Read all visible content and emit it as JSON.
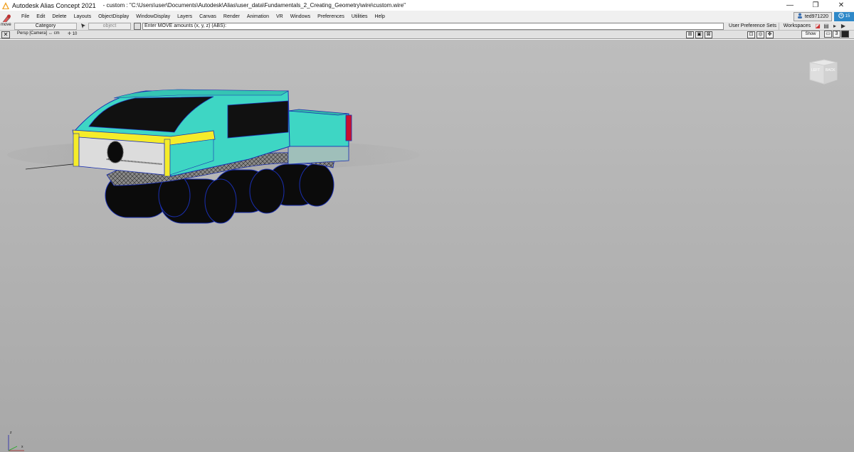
{
  "titlebar": {
    "app_title": "Autodesk Alias Concept 2021",
    "doc_title": "- custom : \"C:\\Users\\user\\Documents\\Autodesk\\Alias\\user_data\\Fundamentals_2_Creating_Geometry\\wire\\custom.wire\""
  },
  "window_controls": {
    "minimize": "—",
    "restore": "❐",
    "close": "✕"
  },
  "menu": {
    "items": [
      "File",
      "Edit",
      "Delete",
      "Layouts",
      "ObjectDisplay",
      "WindowDisplay",
      "Layers",
      "Canvas",
      "Render",
      "Animation",
      "VR",
      "Windows",
      "Preferences",
      "Utilities",
      "Help"
    ]
  },
  "user": {
    "name": "ted971220",
    "clock_text": "15"
  },
  "prompt": {
    "tool_name": "move",
    "category": "Category",
    "object_placeholder": "object",
    "input_value": "Enter MOVE amounts (x, y, z) (ABS):",
    "user_pref_sets": "User Preference Sets",
    "workspaces": "Workspaces"
  },
  "viewport": {
    "label": "Persp [Camera]",
    "units": "↔ cm",
    "grid": "10",
    "show_button": "Show",
    "panel_number": "3",
    "viewcube_top": "LEFT",
    "viewcube_right": "BACK",
    "axis_z": "z",
    "axis_x": "x"
  },
  "colors": {
    "body_teal": "#3ed6c4",
    "window_black": "#111111",
    "trim_yellow": "#f5ec2a",
    "tail_red": "#c8102e",
    "outline_blue": "#1a2fb0",
    "bg_grey": "#b4b4b4",
    "accent_blue": "#2e88c8"
  }
}
